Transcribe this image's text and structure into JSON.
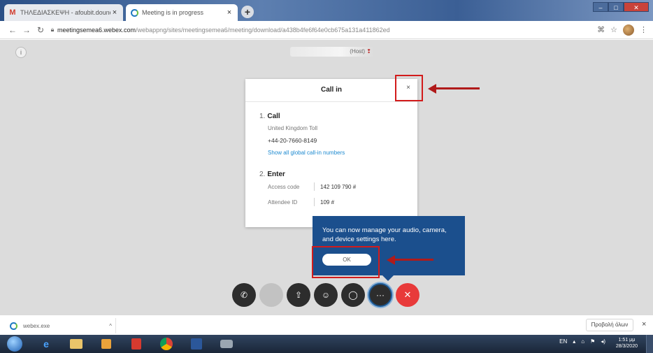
{
  "browser": {
    "tabs": [
      {
        "title": "ΤΗΛΕΔΙΑΣΚΕΨΗ - afoubit.dound",
        "active": false,
        "icon": "gmail-icon"
      },
      {
        "title": "Meeting is in progress",
        "active": true,
        "icon": "webex-icon"
      }
    ],
    "new_tab": "+",
    "url_host": "meetingsemea6.webex.com",
    "url_path": "/webappng/sites/meetingsemea6/meeting/download/a438b4fe6f64e0cb675a131a411862ed"
  },
  "meeting": {
    "host_label": "(Host)",
    "dialog": {
      "title": "Call in",
      "close": "×",
      "step1_num": "1.",
      "step1_label": "Call",
      "country": "United Kingdom Toll",
      "phone": "+44-20-7660-8149",
      "link": "Show all global call-in numbers",
      "step2_num": "2.",
      "step2_label": "Enter",
      "access_code_label": "Access code",
      "access_code": "142 109 790 #",
      "attendee_id_label": "Attendee ID",
      "attendee_id": "109 #"
    },
    "tooltip": {
      "text": "You can now manage your audio, camera, and device settings here.",
      "ok": "OK"
    },
    "controls": [
      {
        "name": "phone-audio-button",
        "icon": "phone-icon",
        "glyph": "✆"
      },
      {
        "name": "video-button",
        "icon": "video-icon",
        "glyph": ""
      },
      {
        "name": "share-button",
        "icon": "share-icon",
        "glyph": "⇪"
      },
      {
        "name": "participants-button",
        "icon": "participants-icon",
        "glyph": "☺"
      },
      {
        "name": "chat-button",
        "icon": "chat-icon",
        "glyph": "◯"
      },
      {
        "name": "more-button",
        "icon": "more-icon",
        "glyph": "···"
      },
      {
        "name": "leave-button",
        "icon": "close-icon",
        "glyph": "✕"
      }
    ]
  },
  "downloads": {
    "file": "webex.exe",
    "show_all": "Προβολή όλων",
    "close": "×"
  },
  "taskbar": {
    "lang": "EN",
    "time": "1:51 μμ",
    "date": "28/3/2020"
  }
}
